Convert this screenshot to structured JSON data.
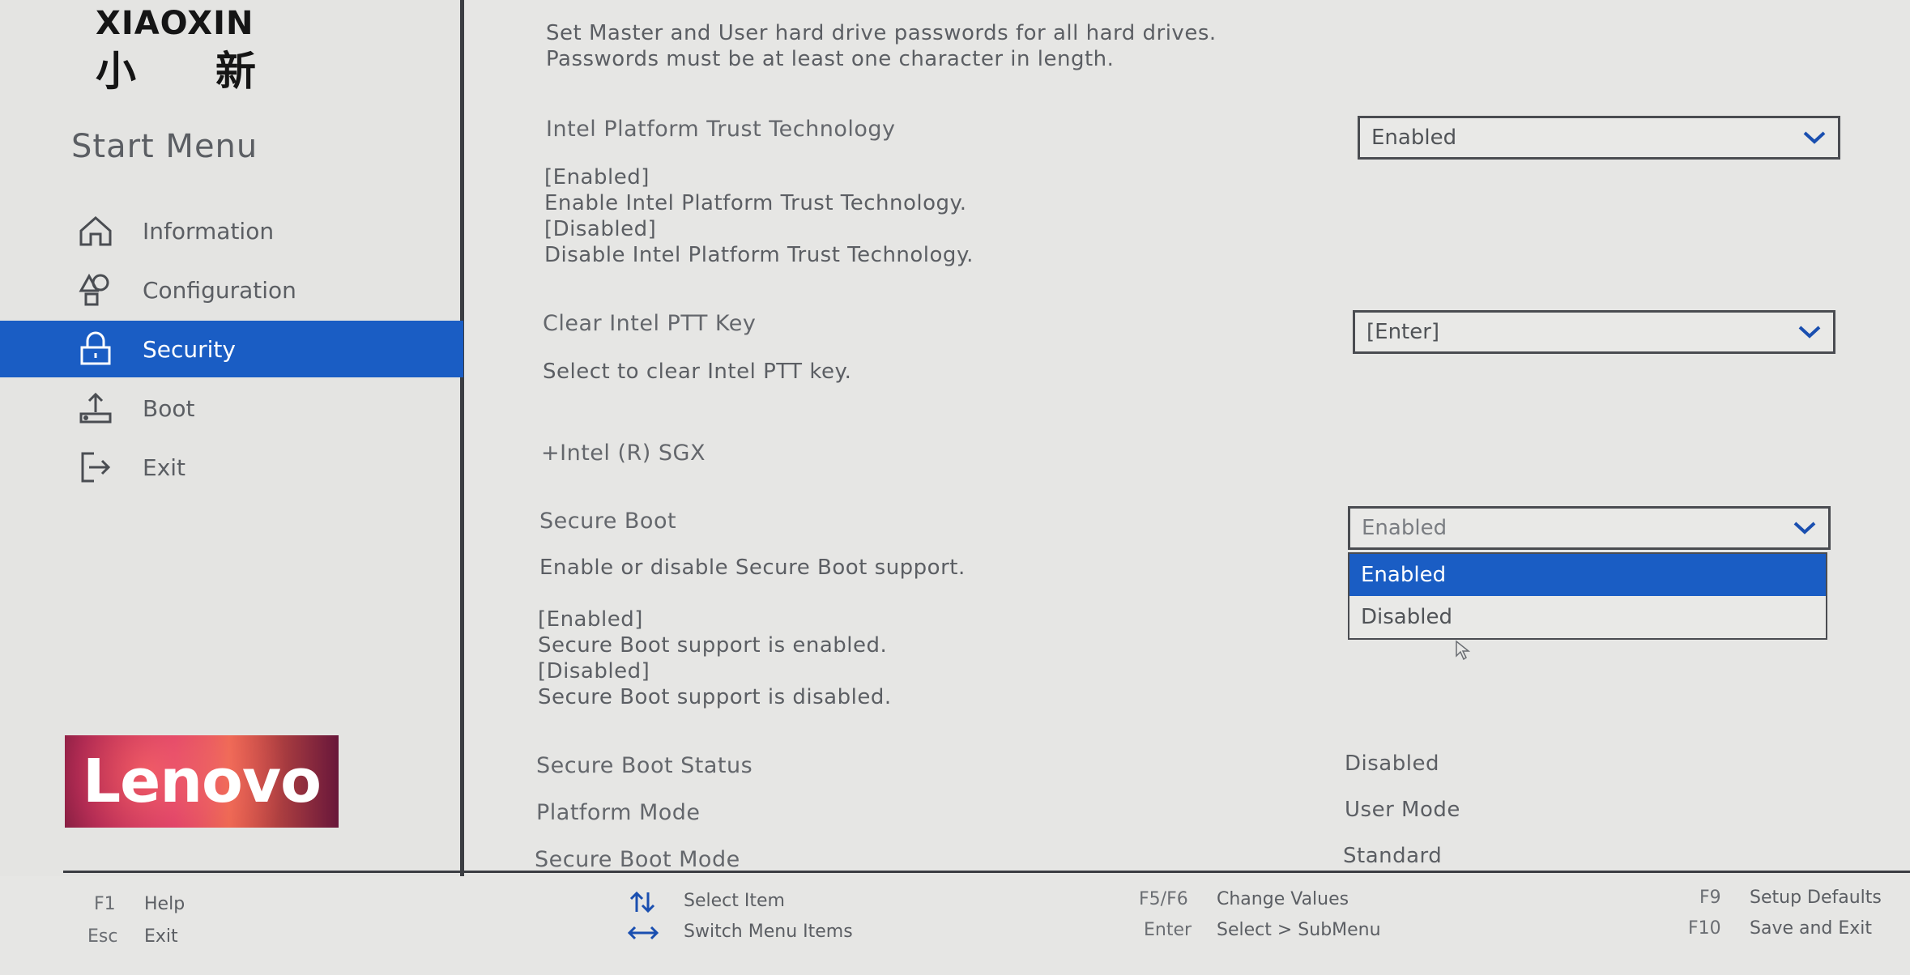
{
  "brand": {
    "name": "XIAOXIN",
    "cn_1": "小",
    "cn_2": "新",
    "logo_text": "Lenovo"
  },
  "sidebar": {
    "title": "Start Menu",
    "items": [
      {
        "label": "Information",
        "icon": "home-icon"
      },
      {
        "label": "Configuration",
        "icon": "shapes-icon"
      },
      {
        "label": "Security",
        "icon": "lock-icon",
        "active": true
      },
      {
        "label": "Boot",
        "icon": "boot-icon"
      },
      {
        "label": "Exit",
        "icon": "exit-icon"
      }
    ]
  },
  "main": {
    "intro_line1": "Set Master and User hard drive passwords for all hard drives.",
    "intro_line2": "Passwords must be at least one character in length.",
    "ptt": {
      "label": "Intel Platform Trust Technology",
      "value": "Enabled",
      "desc": [
        "[Enabled]",
        "Enable Intel Platform Trust Technology.",
        "[Disabled]",
        "Disable Intel Platform Trust Technology."
      ]
    },
    "clear_ptt": {
      "label": "Clear Intel PTT Key",
      "value": "[Enter]",
      "desc": "Select to clear Intel PTT key."
    },
    "sgx": {
      "label": "+Intel (R) SGX"
    },
    "secure_boot": {
      "label": "Secure Boot",
      "value": "Enabled",
      "desc": "Enable or disable Secure Boot support.",
      "desc_details": [
        "[Enabled]",
        "Secure Boot support is enabled.",
        "[Disabled]",
        "Secure Boot support is disabled."
      ],
      "options": [
        "Enabled",
        "Disabled"
      ],
      "highlighted_option": "Enabled"
    },
    "status_rows": [
      {
        "label": "Secure Boot Status",
        "value": "Disabled"
      },
      {
        "label": "Platform Mode",
        "value": "User Mode"
      },
      {
        "label": "Secure Boot Mode",
        "value": "Standard"
      }
    ]
  },
  "footer": {
    "help_key": "F1",
    "help_label": "Help",
    "exit_key": "Esc",
    "exit_label": "Exit",
    "select_item_label": "Select Item",
    "switch_menu_label": "Switch Menu Items",
    "change_key": "F5/F6",
    "change_label": "Change Values",
    "enter_key": "Enter",
    "enter_label": "Select > SubMenu",
    "defaults_key": "F9",
    "defaults_label": "Setup Defaults",
    "save_key": "F10",
    "save_label": "Save and Exit"
  },
  "colors": {
    "accent": "#1a5dc4",
    "background": "#e6e6e4",
    "text": "#5b5e63"
  }
}
